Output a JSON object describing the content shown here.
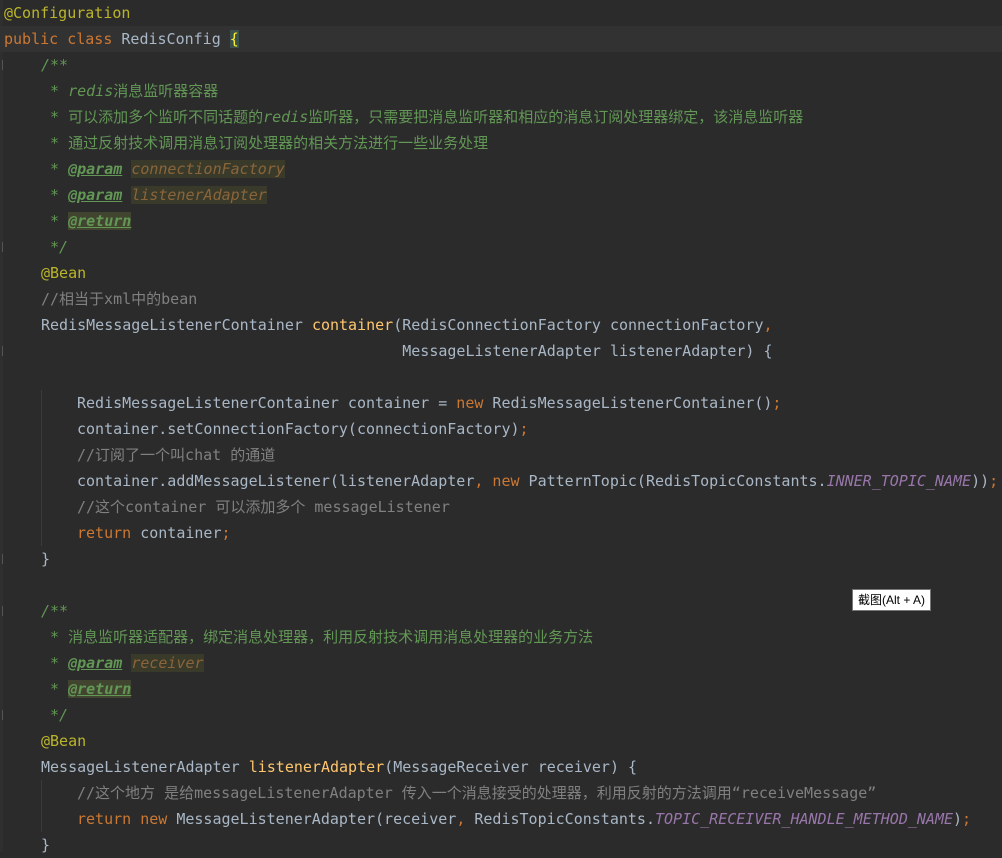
{
  "editor": {
    "lines": [
      {
        "indent": 0,
        "tokens": [
          {
            "t": "@Configuration",
            "c": "ann"
          }
        ]
      },
      {
        "indent": 0,
        "current": true,
        "tokens": [
          {
            "t": "public ",
            "c": "kw"
          },
          {
            "t": "class ",
            "c": "kw"
          },
          {
            "t": "RedisConfig "
          },
          {
            "t": "{",
            "c": "brace-hl"
          }
        ]
      },
      {
        "indent": 1,
        "fold": true,
        "tokens": [
          {
            "t": "/**",
            "c": "doc"
          }
        ]
      },
      {
        "indent": 1,
        "tokens": [
          {
            "t": " * ",
            "c": "doc"
          },
          {
            "t": "redis",
            "c": "doc"
          },
          {
            "t": "消息监听器容器",
            "c": "doc-zh"
          }
        ]
      },
      {
        "indent": 1,
        "tokens": [
          {
            "t": " * ",
            "c": "doc"
          },
          {
            "t": "可以添加多个监听不同话题的",
            "c": "doc-zh"
          },
          {
            "t": "redis",
            "c": "doc"
          },
          {
            "t": "监听器，只需要把消息监听器和相应的消息订阅处理器绑定，该消息监听器",
            "c": "doc-zh"
          }
        ]
      },
      {
        "indent": 1,
        "tokens": [
          {
            "t": " * ",
            "c": "doc"
          },
          {
            "t": "通过反射技术调用消息订阅处理器的相关方法进行一些业务处理",
            "c": "doc-zh"
          }
        ]
      },
      {
        "indent": 1,
        "tokens": [
          {
            "t": " * ",
            "c": "doc"
          },
          {
            "t": "@param",
            "c": "tag"
          },
          {
            "t": " "
          },
          {
            "t": "connectionFactory",
            "c": "tagval"
          }
        ]
      },
      {
        "indent": 1,
        "tokens": [
          {
            "t": " * ",
            "c": "doc"
          },
          {
            "t": "@param",
            "c": "tag"
          },
          {
            "t": " "
          },
          {
            "t": "listenerAdapter",
            "c": "tagval"
          }
        ]
      },
      {
        "indent": 1,
        "tokens": [
          {
            "t": " * ",
            "c": "doc"
          },
          {
            "t": "@return",
            "c": "tag hl"
          }
        ]
      },
      {
        "indent": 1,
        "fold": true,
        "tokens": [
          {
            "t": " */",
            "c": "doc"
          }
        ]
      },
      {
        "indent": 1,
        "tokens": [
          {
            "t": "@Bean",
            "c": "ann"
          }
        ]
      },
      {
        "indent": 1,
        "tokens": [
          {
            "t": "//相当于xml中的bean",
            "c": "cmt"
          }
        ]
      },
      {
        "indent": 1,
        "tokens": [
          {
            "t": "RedisMessageListenerContainer "
          },
          {
            "t": "container",
            "c": "fn"
          },
          {
            "t": "(RedisConnectionFactory connectionFactory"
          },
          {
            "t": ",",
            "c": "kw"
          }
        ]
      },
      {
        "indent": 1,
        "fold": true,
        "tokens": [
          {
            "t": "                                        MessageListenerAdapter listenerAdapter) {"
          }
        ]
      },
      {
        "indent": 1,
        "tokens": []
      },
      {
        "indent": 2,
        "tokens": [
          {
            "t": "RedisMessageListenerContainer container = "
          },
          {
            "t": "new ",
            "c": "kw"
          },
          {
            "t": "RedisMessageListenerContainer()"
          },
          {
            "t": ";",
            "c": "kw"
          }
        ]
      },
      {
        "indent": 2,
        "tokens": [
          {
            "t": "container.setConnectionFactory(connectionFactory)"
          },
          {
            "t": ";",
            "c": "kw"
          }
        ]
      },
      {
        "indent": 2,
        "tokens": [
          {
            "t": "//订阅了一个叫chat 的通道",
            "c": "cmt"
          }
        ]
      },
      {
        "indent": 2,
        "tokens": [
          {
            "t": "container.addMessageListener(listenerAdapter"
          },
          {
            "t": ", ",
            "c": "kw"
          },
          {
            "t": "new ",
            "c": "kw"
          },
          {
            "t": "PatternTopic(RedisTopicConstants."
          },
          {
            "t": "INNER_TOPIC_NAME",
            "c": "const"
          },
          {
            "t": "))"
          },
          {
            "t": ";",
            "c": "kw"
          }
        ]
      },
      {
        "indent": 2,
        "tokens": [
          {
            "t": "//这个container 可以添加多个 messageListener",
            "c": "cmt"
          }
        ]
      },
      {
        "indent": 2,
        "tokens": [
          {
            "t": "return ",
            "c": "kw"
          },
          {
            "t": "container"
          },
          {
            "t": ";",
            "c": "kw"
          }
        ]
      },
      {
        "indent": 1,
        "fold": true,
        "tokens": [
          {
            "t": "}"
          }
        ]
      },
      {
        "indent": 0,
        "tokens": []
      },
      {
        "indent": 1,
        "fold": true,
        "tokens": [
          {
            "t": "/**",
            "c": "doc"
          }
        ]
      },
      {
        "indent": 1,
        "tokens": [
          {
            "t": " * ",
            "c": "doc"
          },
          {
            "t": "消息监听器适配器，绑定消息处理器，利用反射技术调用消息处理器的业务方法",
            "c": "doc-zh"
          }
        ]
      },
      {
        "indent": 1,
        "tokens": [
          {
            "t": " * ",
            "c": "doc"
          },
          {
            "t": "@param",
            "c": "tag"
          },
          {
            "t": " "
          },
          {
            "t": "receiver",
            "c": "tagval"
          }
        ]
      },
      {
        "indent": 1,
        "tokens": [
          {
            "t": " * ",
            "c": "doc"
          },
          {
            "t": "@return",
            "c": "tag hl"
          }
        ]
      },
      {
        "indent": 1,
        "fold": true,
        "tokens": [
          {
            "t": " */",
            "c": "doc"
          }
        ]
      },
      {
        "indent": 1,
        "tokens": [
          {
            "t": "@Bean",
            "c": "ann"
          }
        ]
      },
      {
        "indent": 1,
        "tokens": [
          {
            "t": "MessageListenerAdapter "
          },
          {
            "t": "listenerAdapter",
            "c": "fn"
          },
          {
            "t": "(MessageReceiver receiver) {"
          }
        ]
      },
      {
        "indent": 2,
        "tokens": [
          {
            "t": "//这个地方 是给messageListenerAdapter 传入一个消息接受的处理器，利用反射的方法调用“receiveMessage”",
            "c": "cmt"
          }
        ]
      },
      {
        "indent": 2,
        "tokens": [
          {
            "t": "return ",
            "c": "kw"
          },
          {
            "t": "new ",
            "c": "kw"
          },
          {
            "t": "MessageListenerAdapter(receiver"
          },
          {
            "t": ", ",
            "c": "kw"
          },
          {
            "t": "RedisTopicConstants."
          },
          {
            "t": "TOPIC_RECEIVER_HANDLE_METHOD_NAME",
            "c": "const"
          },
          {
            "t": ")"
          },
          {
            "t": ";",
            "c": "kw"
          }
        ]
      },
      {
        "indent": 1,
        "tokens": [
          {
            "t": "}"
          }
        ]
      }
    ]
  },
  "tooltip": {
    "label": "截图(Alt + A)"
  }
}
